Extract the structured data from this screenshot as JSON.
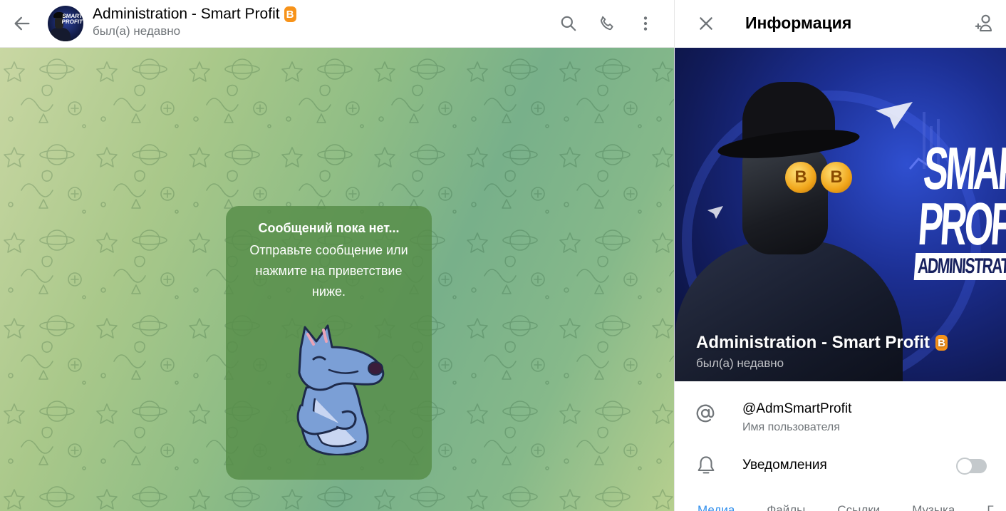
{
  "colors": {
    "accent": "#3390ec",
    "secondary_text": "#707579",
    "bitcoin": "#f7931a",
    "empty_card_bg": "#568c48"
  },
  "chat_header": {
    "title": "Administration - Smart Profit",
    "title_badge": "B",
    "status": "был(а) недавно",
    "icons": [
      "back-arrow-icon",
      "search-icon",
      "phone-icon",
      "more-vertical-icon"
    ]
  },
  "avatar": {
    "label_line1": "SMART",
    "label_line2": "PROFIT"
  },
  "empty_state": {
    "title": "Сообщений пока нет...",
    "text": "Отправьте сообщение или нажмите на приветствие ниже."
  },
  "info_panel": {
    "title": "Информация",
    "cover": {
      "logo_line1": "SMART",
      "logo_line2": "PROFIT",
      "logo_line3": "ADMINISTRATION",
      "coin_symbol": "B",
      "name": "Administration - Smart Profit",
      "name_badge": "B",
      "status": "был(а) недавно"
    },
    "username": {
      "value": "@AdmSmartProfit",
      "label": "Имя пользователя"
    },
    "notifications": {
      "label": "Уведомления",
      "enabled": false
    },
    "media_tabs": [
      {
        "label": "Медиа",
        "active": true
      },
      {
        "label": "Файлы",
        "active": false
      },
      {
        "label": "Ссылки",
        "active": false
      },
      {
        "label": "Музыка",
        "active": false
      },
      {
        "label": "Г",
        "active": false
      }
    ]
  }
}
